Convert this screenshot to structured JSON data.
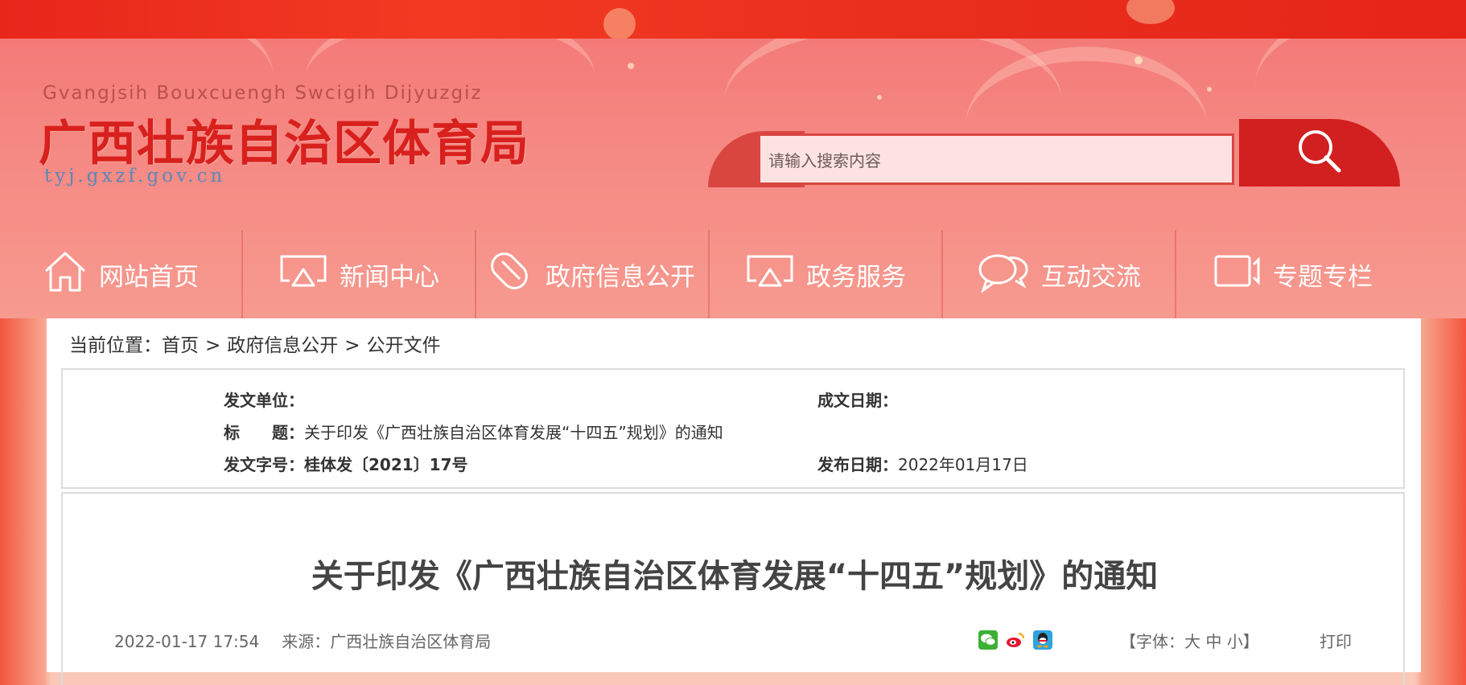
{
  "header": {
    "pinyin": "Gvangjsih Bouxcuengh Swcigih Dijyuzgiz",
    "site_name": "广西壮族自治区体育局",
    "domain": "tyj.gxzf.gov.cn"
  },
  "search": {
    "placeholder": "请输入搜索内容",
    "button_icon": "search-icon"
  },
  "nav": {
    "items": [
      {
        "label": "网站首页",
        "icon": "home-icon"
      },
      {
        "label": "新闻中心",
        "icon": "broadcast-icon"
      },
      {
        "label": "政府信息公开",
        "icon": "capsule-icon"
      },
      {
        "label": "政务服务",
        "icon": "broadcast-icon"
      },
      {
        "label": "互动交流",
        "icon": "chat-bubbles-icon"
      },
      {
        "label": "专题专栏",
        "icon": "video-icon"
      }
    ]
  },
  "breadcrumb": {
    "prefix": "当前位置：",
    "items": [
      "首页",
      "政府信息公开",
      "公开文件"
    ],
    "separator": ">"
  },
  "meta": {
    "issuer_label": "发文单位：",
    "issuer_value": "",
    "date_written_label": "成文日期：",
    "date_written_value": "",
    "title_label": "标　　题：",
    "title_value": "关于印发《广西壮族自治区体育发展“十四五”规划》的通知",
    "doc_no_label": "发文字号：",
    "doc_no_value": "桂体发〔2021〕17号",
    "publish_date_label": "发布日期：",
    "publish_date_value": "2022年01月17日"
  },
  "article": {
    "title": "关于印发《广西壮族自治区体育发展“十四五”规划》的通知",
    "datetime": "2022-01-17 17:54",
    "source": "来源：广西壮族自治区体育局",
    "share_icons": [
      "wechat-icon",
      "weibo-icon",
      "qq-icon"
    ],
    "font_size_label": "【字体：",
    "font_large": "大",
    "font_medium": "中",
    "font_small": "小",
    "font_size_close": "】",
    "print_label": "打印"
  },
  "colors": {
    "brand_red": "#d8201d",
    "nav_text": "#ffffff",
    "header_bg": "#f58983"
  }
}
